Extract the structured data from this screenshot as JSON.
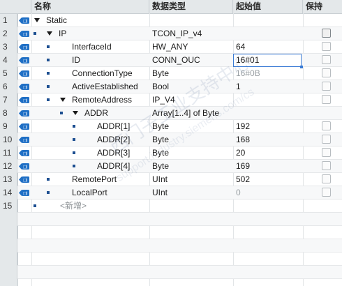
{
  "header": {
    "name": "名称",
    "type": "数据类型",
    "start": "起始值",
    "retain": "保持"
  },
  "rows": [
    {
      "num": "1",
      "name": "Static",
      "type": "",
      "value": ""
    },
    {
      "num": "2",
      "name": "IP",
      "type": "TCON_IP_v4",
      "value": ""
    },
    {
      "num": "3",
      "name": "InterfaceId",
      "type": "HW_ANY",
      "value": "64"
    },
    {
      "num": "4",
      "name": "ID",
      "type": "CONN_OUC",
      "value": "16#01"
    },
    {
      "num": "5",
      "name": "ConnectionType",
      "type": "Byte",
      "value": "16#0B"
    },
    {
      "num": "6",
      "name": "ActiveEstablished",
      "type": "Bool",
      "value": "1"
    },
    {
      "num": "7",
      "name": "RemoteAddress",
      "type": "IP_V4",
      "value": ""
    },
    {
      "num": "8",
      "name": "ADDR",
      "type": "Array[1..4] of Byte",
      "value": ""
    },
    {
      "num": "9",
      "name": "ADDR[1]",
      "type": "Byte",
      "value": "192"
    },
    {
      "num": "10",
      "name": "ADDR[2]",
      "type": "Byte",
      "value": "168"
    },
    {
      "num": "11",
      "name": "ADDR[3]",
      "type": "Byte",
      "value": "20"
    },
    {
      "num": "12",
      "name": "ADDR[4]",
      "type": "Byte",
      "value": "169"
    },
    {
      "num": "13",
      "name": "RemotePort",
      "type": "UInt",
      "value": "502"
    },
    {
      "num": "14",
      "name": "LocalPort",
      "type": "UInt",
      "value": "0"
    },
    {
      "num": "15",
      "name": "<新增>",
      "type": "",
      "value": ""
    }
  ],
  "watermark": {
    "line1": "西门子工业支持中心",
    "line2": "support.industry.siemens.com/cs"
  },
  "icons": {
    "io_badge": "db-interface-io-icon",
    "expand": "expand-triangle-icon",
    "member": "member-square-icon",
    "checkbox": "retain-checkbox"
  },
  "colors": {
    "header_bg": "#e4e8ea",
    "selection_border": "#3a7bd5",
    "io_icon_blue": "#1f6fc5"
  }
}
